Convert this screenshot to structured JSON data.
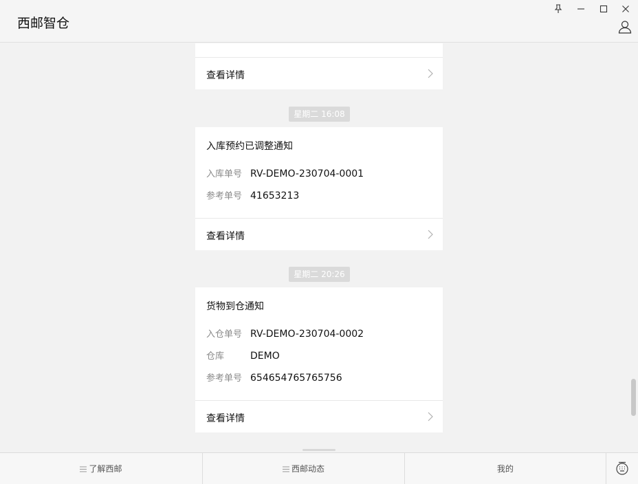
{
  "window": {
    "title": "西邮智仓",
    "controls": [
      "pin-icon",
      "minimize-icon",
      "maximize-icon",
      "close-icon"
    ],
    "user_icon": "user-icon"
  },
  "chat": {
    "top_card": {
      "detail_label": "查看详情"
    },
    "messages": [
      {
        "timestamp": "星期二  16:08",
        "title": "入库预约已调整通知",
        "fields": [
          {
            "label": "入库单号",
            "value": "RV-DEMO-230704-0001"
          },
          {
            "label": "参考单号",
            "value": "41653213"
          }
        ],
        "detail_label": "查看详情"
      },
      {
        "timestamp": "星期二  20:26",
        "title": "货物到仓通知",
        "fields": [
          {
            "label": "入仓单号",
            "value": "RV-DEMO-230704-0002"
          },
          {
            "label": "仓库",
            "value": "DEMO"
          },
          {
            "label": "参考单号",
            "value": "654654765765756"
          }
        ],
        "detail_label": "查看详情"
      }
    ]
  },
  "bottom_menu": {
    "items": [
      {
        "label": "了解西邮",
        "icon": "menu-icon"
      },
      {
        "label": "西邮动态",
        "icon": "menu-icon"
      },
      {
        "label": "我的"
      }
    ],
    "keyboard_toggle_icon": "keyboard-icon"
  },
  "colors": {
    "background": "#f2f2f2",
    "card": "#ffffff",
    "timestamp_bg": "#dadada",
    "label": "#8a8a8a"
  }
}
